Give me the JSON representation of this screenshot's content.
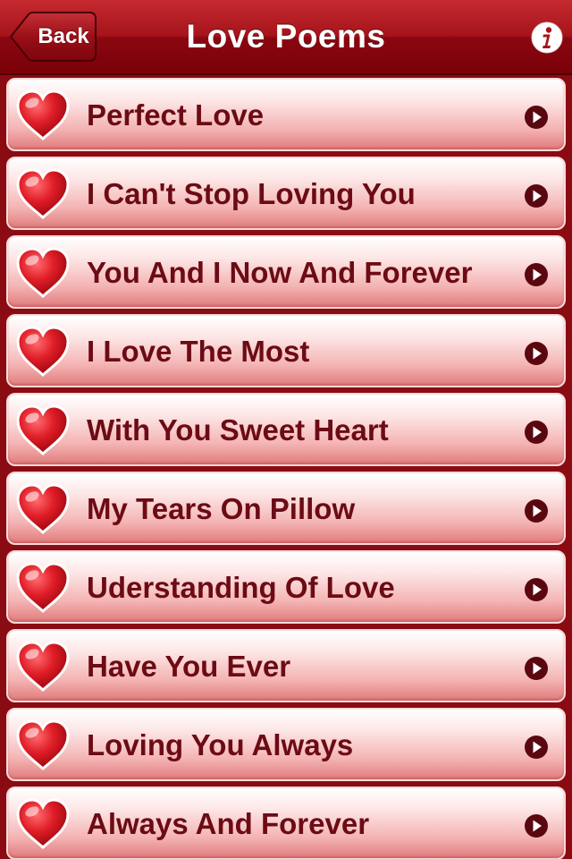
{
  "header": {
    "back_label": "Back",
    "title": "Love Poems",
    "info_icon": "info-icon"
  },
  "poems": [
    {
      "label": "Perfect Love"
    },
    {
      "label": "I Can't Stop Loving You"
    },
    {
      "label": "You And I Now And Forever"
    },
    {
      "label": "I Love The Most"
    },
    {
      "label": "With You Sweet Heart"
    },
    {
      "label": "My Tears On Pillow"
    },
    {
      "label": "Uderstanding Of Love"
    },
    {
      "label": "Have You Ever"
    },
    {
      "label": "Loving You Always"
    },
    {
      "label": "Always And Forever"
    }
  ],
  "colors": {
    "navbar": "#a6141b",
    "background": "#8a0b12",
    "row_text": "#6c0b14",
    "accent": "#d11c26"
  }
}
